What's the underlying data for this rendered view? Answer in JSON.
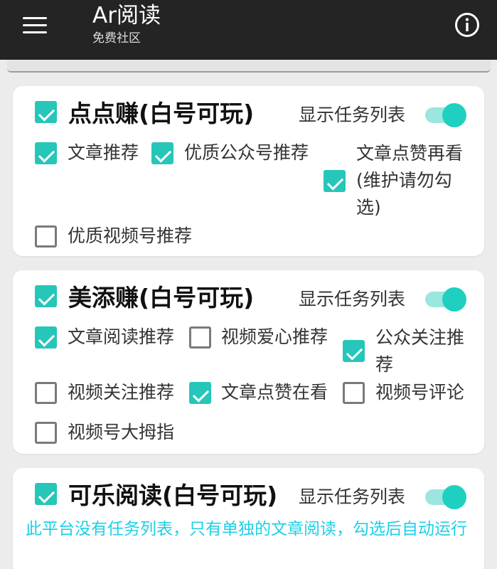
{
  "app": {
    "title": "Ar阅读",
    "subtitle": "免费社区"
  },
  "show_tasks_label": "显示任务列表",
  "cards": [
    {
      "title": "点点赚(白号可玩)",
      "enabled": true,
      "show_tasks": true,
      "options": [
        {
          "label": "文章推荐",
          "checked": true
        },
        {
          "label": "优质公众号推荐",
          "checked": true
        },
        {
          "label": "文章点赞再看(维护请勿勾选)",
          "checked": true
        },
        {
          "label": "优质视频号推荐",
          "checked": false
        }
      ]
    },
    {
      "title": "美添赚(白号可玩)",
      "enabled": true,
      "show_tasks": true,
      "options": [
        {
          "label": "文章阅读推荐",
          "checked": true
        },
        {
          "label": "视频爱心推荐",
          "checked": false
        },
        {
          "label": "公众关注推荐",
          "checked": true
        },
        {
          "label": "视频关注推荐",
          "checked": false
        },
        {
          "label": "文章点赞在看",
          "checked": true
        },
        {
          "label": "视频号评论",
          "checked": false
        },
        {
          "label": "视频号大拇指",
          "checked": false
        }
      ]
    },
    {
      "title": "可乐阅读(白号可玩)",
      "enabled": true,
      "show_tasks": true,
      "note": "此平台没有任务列表，只有单独的文章阅读，勾选后自动运行"
    }
  ]
}
